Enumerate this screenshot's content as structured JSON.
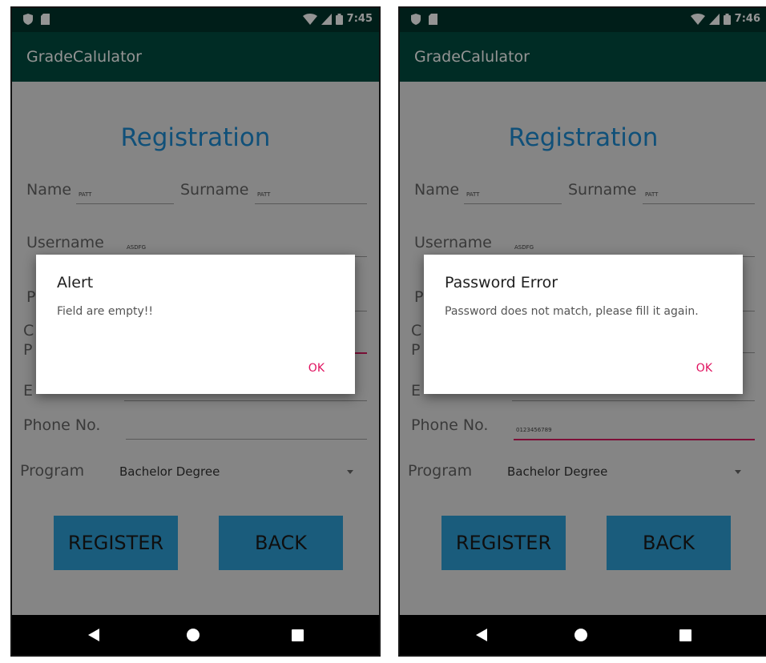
{
  "screens": [
    {
      "status": {
        "time": "7:45"
      },
      "app_title": "GradeCalulator",
      "form": {
        "title": "Registration",
        "name_label": "Name",
        "name_value": "PATT",
        "surname_label": "Surname",
        "surname_value": "PATT",
        "username_label": "Username",
        "username_value": "ASDFG",
        "phone_label": "Phone No.",
        "phone_value": "",
        "program_label": "Program",
        "program_value": "Bachelor Degree",
        "register_label": "REGISTER",
        "back_label": "BACK",
        "partial_p": "P",
        "partial_c": "C",
        "partial_p2": "P",
        "partial_e": "E"
      },
      "dialog": {
        "title": "Alert",
        "message": "Field are empty!!",
        "ok": "OK"
      }
    },
    {
      "status": {
        "time": "7:46"
      },
      "app_title": "GradeCalulator",
      "form": {
        "title": "Registration",
        "name_label": "Name",
        "name_value": "PATT",
        "surname_label": "Surname",
        "surname_value": "PATT",
        "username_label": "Username",
        "username_value": "ASDFG",
        "phone_label": "Phone No.",
        "phone_value": "0123456789",
        "program_label": "Program",
        "program_value": "Bachelor Degree",
        "register_label": "REGISTER",
        "back_label": "BACK",
        "partial_p": "P",
        "partial_c": "C",
        "partial_p2": "P",
        "partial_e": "E"
      },
      "dialog": {
        "title": "Password Error",
        "message": "Password does not match, please fill it again.",
        "ok": "OK"
      }
    }
  ],
  "colors": {
    "status_bar": "#00352b",
    "app_bar": "#004d40",
    "accent_title": "#1d8bd0",
    "button": "#2d9fd6",
    "dialog_ok": "#e0115f",
    "focus_underline": "#d81b60"
  },
  "icons": [
    "shield-icon",
    "sd-card-icon",
    "wifi-icon",
    "signal-icon",
    "battery-icon",
    "back-nav-icon",
    "home-nav-icon",
    "recents-nav-icon"
  ]
}
